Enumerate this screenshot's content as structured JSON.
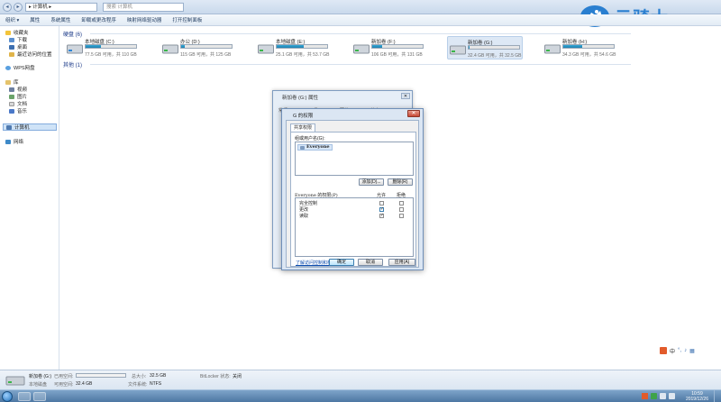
{
  "titlebar": {
    "back": "◂",
    "forward": "▸",
    "address": "▸ 计算机 ▸",
    "search_placeholder": "搜索 计算机"
  },
  "toolbar": {
    "items": [
      "组织 ▾",
      "属性",
      "系统属性",
      "卸载或更改程序",
      "映射网络驱动器",
      "打开控制面板"
    ]
  },
  "sidebar": {
    "favorites": "收藏夹",
    "fav_items": [
      "下载",
      "桌面",
      "最近访问的位置"
    ],
    "wps": "WPS网盘",
    "libraries": "库",
    "lib_items": [
      "视频",
      "图片",
      "文档",
      "音乐"
    ],
    "computer": "计算机",
    "network": "网络"
  },
  "main": {
    "drives_heading": "硬盘 (6)",
    "other_heading": "其他 (1)",
    "drives": [
      {
        "name": "本地磁盘 (C:)",
        "info": "77.5 GB 可用，共 110 GB",
        "used": 0.3
      },
      {
        "name": "办公 (D:)",
        "info": "115 GB 可用，共 125 GB",
        "used": 0.08
      },
      {
        "name": "本地磁盘 (E:)",
        "info": "25.1 GB 可用，共 53.7 GB",
        "used": 0.53
      },
      {
        "name": "新加卷 (F:)",
        "info": "106 GB 可用，共 131 GB",
        "used": 0.19
      },
      {
        "name": "新加卷 (G:)",
        "info": "32.4 GB 可用，共 32.5 GB",
        "used": 0.01
      },
      {
        "name": "新加卷 (H:)",
        "info": "34.3 GB 可用，共 54.6 GB",
        "used": 0.37
      }
    ]
  },
  "backwin": {
    "title": "新加卷 (G:) 属性",
    "tabs": [
      "常规",
      "工具",
      "硬件",
      "共享"
    ],
    "close": "✕"
  },
  "dialog": {
    "title": "G 的权限",
    "tab": "共享权限",
    "group_label": "组或用户名(G):",
    "user": "Everyone",
    "add_button": "添加(D)...",
    "remove_button": "删除(R)",
    "perm_header": "Everyone 的权限(P)",
    "allow_header": "允许",
    "deny_header": "拒绝",
    "permissions": [
      {
        "name": "完全控制",
        "allow": "",
        "deny": ""
      },
      {
        "name": "更改",
        "allow": "✓",
        "deny": ""
      },
      {
        "name": "读取",
        "allow": "✓",
        "deny": ""
      }
    ],
    "help_link": "了解访问控制和权限",
    "ok": "确定",
    "cancel": "取消",
    "apply": "应用(A)",
    "close": "✕"
  },
  "details": {
    "name": "新加卷 (G:)",
    "type": "本地磁盘",
    "used_label": "已用空间:",
    "free_label": "可用空间:",
    "free_value": "32.4 GB",
    "total_label": "总大小:",
    "total_value": "32.5 GB",
    "fs_label": "文件系统:",
    "fs_value": "NTFS",
    "bitlocker_label": "BitLocker 状态:",
    "bitlocker_value": "关闭"
  },
  "taskbar": {
    "time": "10:59",
    "date": "2019/12/26"
  },
  "watermark": {
    "text": "云骑士"
  },
  "ime": {
    "label": "中"
  },
  "colors": {
    "accent": "#2a7fd0",
    "drive_fill": "#1d7fb0",
    "link": "#0f4fb0"
  }
}
